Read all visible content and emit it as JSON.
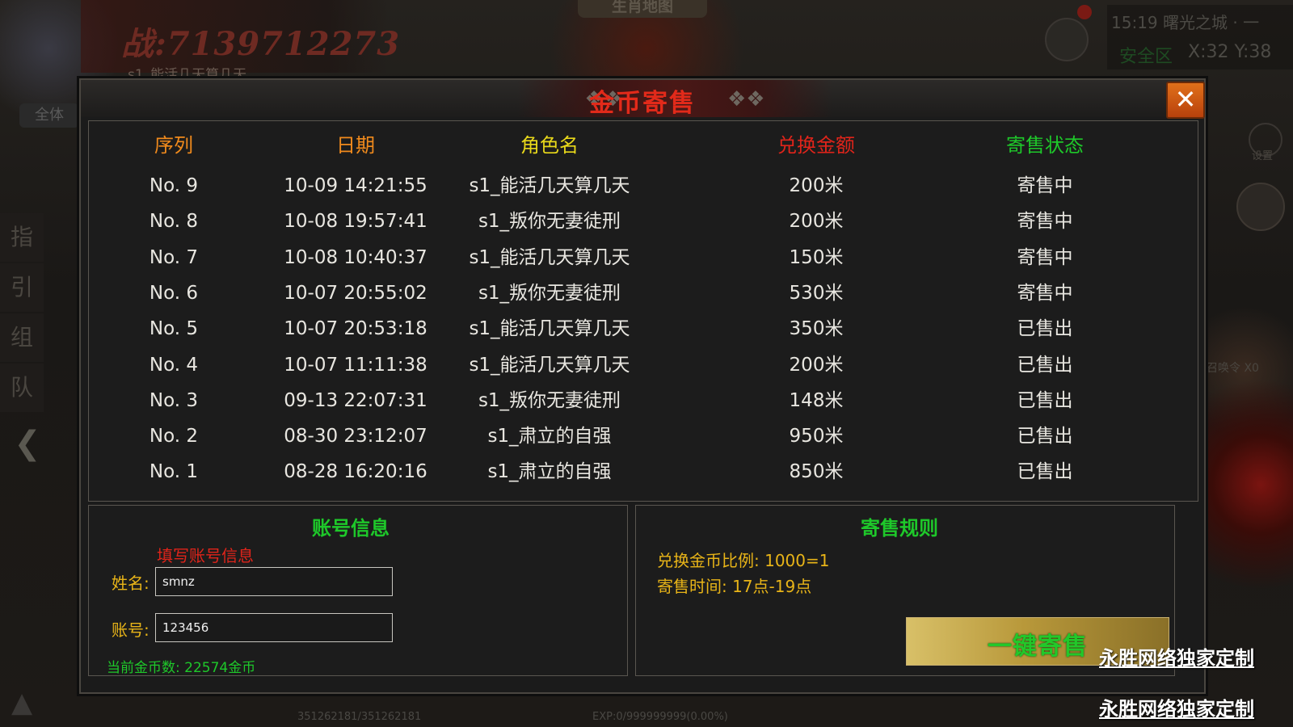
{
  "background": {
    "top_score": "战:7139712273",
    "top_sub": "s1_能活几天算几天",
    "map_title": "生肖地图",
    "time_location": "15:19 曙光之城 · 一",
    "safe_zone": "安全区",
    "coords": "X:32 Y:38",
    "all_label": "全体",
    "side_tabs": [
      "指",
      "引",
      "组",
      "队"
    ],
    "settings_label": "设置",
    "summon_label": "召唤令 X0",
    "hp": "351262181/351262181",
    "exp": "EXP:0/999999999(0.00%)"
  },
  "dialog": {
    "title": "金币寄售",
    "close_icon": "close-x-icon"
  },
  "table": {
    "headers": [
      "序列",
      "日期",
      "角色名",
      "兑换金额",
      "寄售状态"
    ],
    "header_colors": [
      "#f08a1c",
      "#f08a1c",
      "#e8d81a",
      "#e0241a",
      "#1ec82a"
    ],
    "rows": [
      {
        "seq": "No. 9",
        "date": "10-09  14:21:55",
        "role": "s1_能活几天算几天",
        "amount": "200米",
        "status": "寄售中"
      },
      {
        "seq": "No. 8",
        "date": "10-08  19:57:41",
        "role": "s1_叛你无妻徒刑",
        "amount": "200米",
        "status": "寄售中"
      },
      {
        "seq": "No. 7",
        "date": "10-08  10:40:37",
        "role": "s1_能活几天算几天",
        "amount": "150米",
        "status": "寄售中"
      },
      {
        "seq": "No. 6",
        "date": "10-07  20:55:02",
        "role": "s1_叛你无妻徒刑",
        "amount": "530米",
        "status": "寄售中"
      },
      {
        "seq": "No. 5",
        "date": "10-07  20:53:18",
        "role": "s1_能活几天算几天",
        "amount": "350米",
        "status": "已售出"
      },
      {
        "seq": "No. 4",
        "date": "10-07  11:11:38",
        "role": "s1_能活几天算几天",
        "amount": "200米",
        "status": "已售出"
      },
      {
        "seq": "No. 3",
        "date": "09-13  22:07:31",
        "role": "s1_叛你无妻徒刑",
        "amount": "148米",
        "status": "已售出"
      },
      {
        "seq": "No. 2",
        "date": "08-30  23:12:07",
        "role": "s1_肃立的自强",
        "amount": "950米",
        "status": "已售出"
      },
      {
        "seq": "No. 1",
        "date": "08-28  16:20:16",
        "role": "s1_肃立的自强",
        "amount": "850米",
        "status": "已售出"
      }
    ]
  },
  "account": {
    "title": "账号信息",
    "note": "填写账号信息",
    "name_label": "姓名:",
    "name_value": "smnz",
    "account_label": "账号:",
    "account_value": "123456",
    "gold_count": "当前金币数: 22574金币"
  },
  "rules": {
    "title": "寄售规则",
    "ratio": "兑换金币比例: 1000=1",
    "time": "寄售时间: 17点-19点",
    "sell_button": "一键寄售"
  },
  "watermarks": [
    "永胜网络独家定制",
    "永胜网络独家定制"
  ]
}
